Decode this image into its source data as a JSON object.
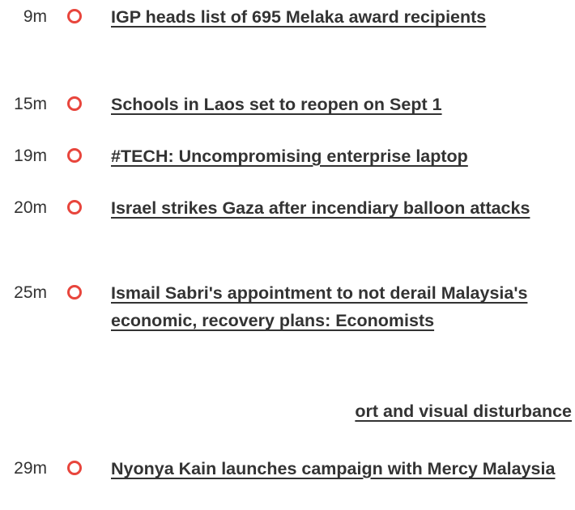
{
  "feed": {
    "items": [
      {
        "time": "9m",
        "title": "IGP heads list of 695 Melaka award recipients"
      },
      {
        "time": "15m",
        "title": "Schools in Laos set to reopen on Sept 1"
      },
      {
        "time": "19m",
        "title": "#TECH: Uncompromising enterprise laptop"
      },
      {
        "time": "20m",
        "title": "Israel strikes Gaza after incendiary balloon attacks"
      },
      {
        "time": "25m",
        "title": "Ismail Sabri's appointment to not derail Malaysia's economic, recovery plans: Economists"
      },
      {
        "time": "",
        "title": "ort and visual disturbance"
      },
      {
        "time": "29m",
        "title": "Nyonya Kain launches campaign with Mercy Malaysia"
      }
    ]
  },
  "colors": {
    "dot": "#e8453c",
    "text": "#333333"
  },
  "icons": {
    "timeline_dot": "circle-outline-icon"
  }
}
